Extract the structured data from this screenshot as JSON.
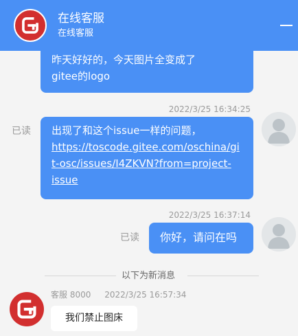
{
  "colors": {
    "accent": "#4a90f5",
    "brand": "#d22f2f",
    "background": "#f4f4f4"
  },
  "header": {
    "title": "在线客服",
    "subtitle": "在线客服",
    "logo_icon": "gitee-logo-icon",
    "minimize_icon": "minimize-icon"
  },
  "messages": [
    {
      "lines": [
        "昨天好好的，今天图片全变成了",
        "gitee的logo"
      ]
    },
    {
      "timestamp": "2022/3/25 16:34:25",
      "read_status": "已读",
      "lines": [
        "出现了和这个issue一样的问题，"
      ],
      "link_lines": [
        "https://toscode.gitee.com/oschina/gi",
        "t-osc/issues/I4ZKVN?from=project-",
        "issue"
      ]
    },
    {
      "timestamp": "2022/3/25 16:37:14",
      "read_status": "已读",
      "lines": [
        "你好，请问在吗"
      ]
    }
  ],
  "divider": {
    "label": "以下为新消息"
  },
  "agent_message": {
    "sender": "客服 8000",
    "timestamp": "2022/3/25 16:57:34",
    "text": "我们禁止图床"
  }
}
